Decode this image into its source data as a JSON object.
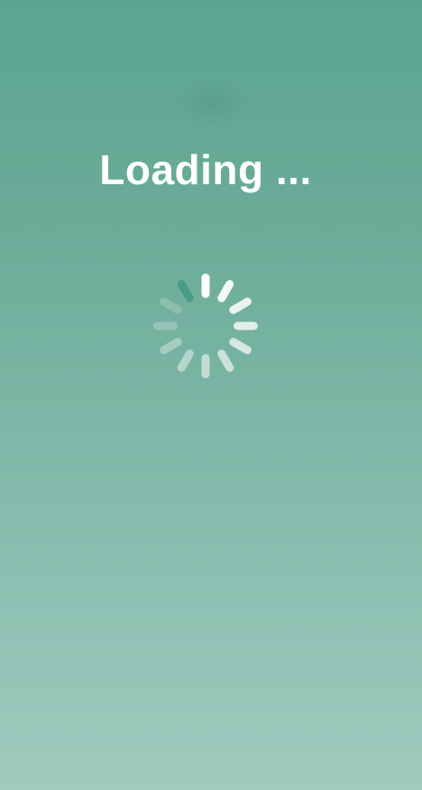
{
  "loading": {
    "message": "Loading ..."
  },
  "spinner": {
    "segments": 12,
    "color": "#ffffff",
    "active_color": "#3f9a80",
    "icon": "spinner-icon"
  },
  "background": {
    "top_color": "#5ba591",
    "bottom_color": "#a0cbbf"
  }
}
